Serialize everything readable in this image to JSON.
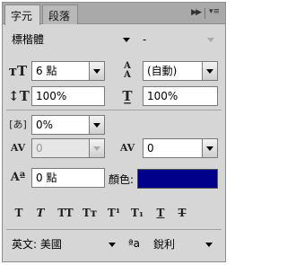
{
  "tabs": {
    "character": "字元",
    "paragraph": "段落"
  },
  "font": {
    "family": "標楷體",
    "style": "-"
  },
  "size": {
    "font_size": "6 點",
    "leading": "(自動)"
  },
  "scale": {
    "vertical": "100%",
    "horizontal": "100%"
  },
  "tsume": {
    "value": "0%"
  },
  "kerning": {
    "value": "0"
  },
  "tracking": {
    "value": "0"
  },
  "baseline": {
    "value": "0 點"
  },
  "color": {
    "label": "顏色:",
    "swatch": "#00008b"
  },
  "styles": {
    "faux_bold": "T",
    "faux_italic": "T",
    "all_caps": "TT",
    "small_caps": "Tт",
    "superscript": "T¹",
    "subscript": "T₁",
    "underline": "T",
    "strikethrough": "T"
  },
  "bottom": {
    "language": "英文: 美國",
    "aa_icon": "ªa",
    "antialias": "銳利"
  }
}
